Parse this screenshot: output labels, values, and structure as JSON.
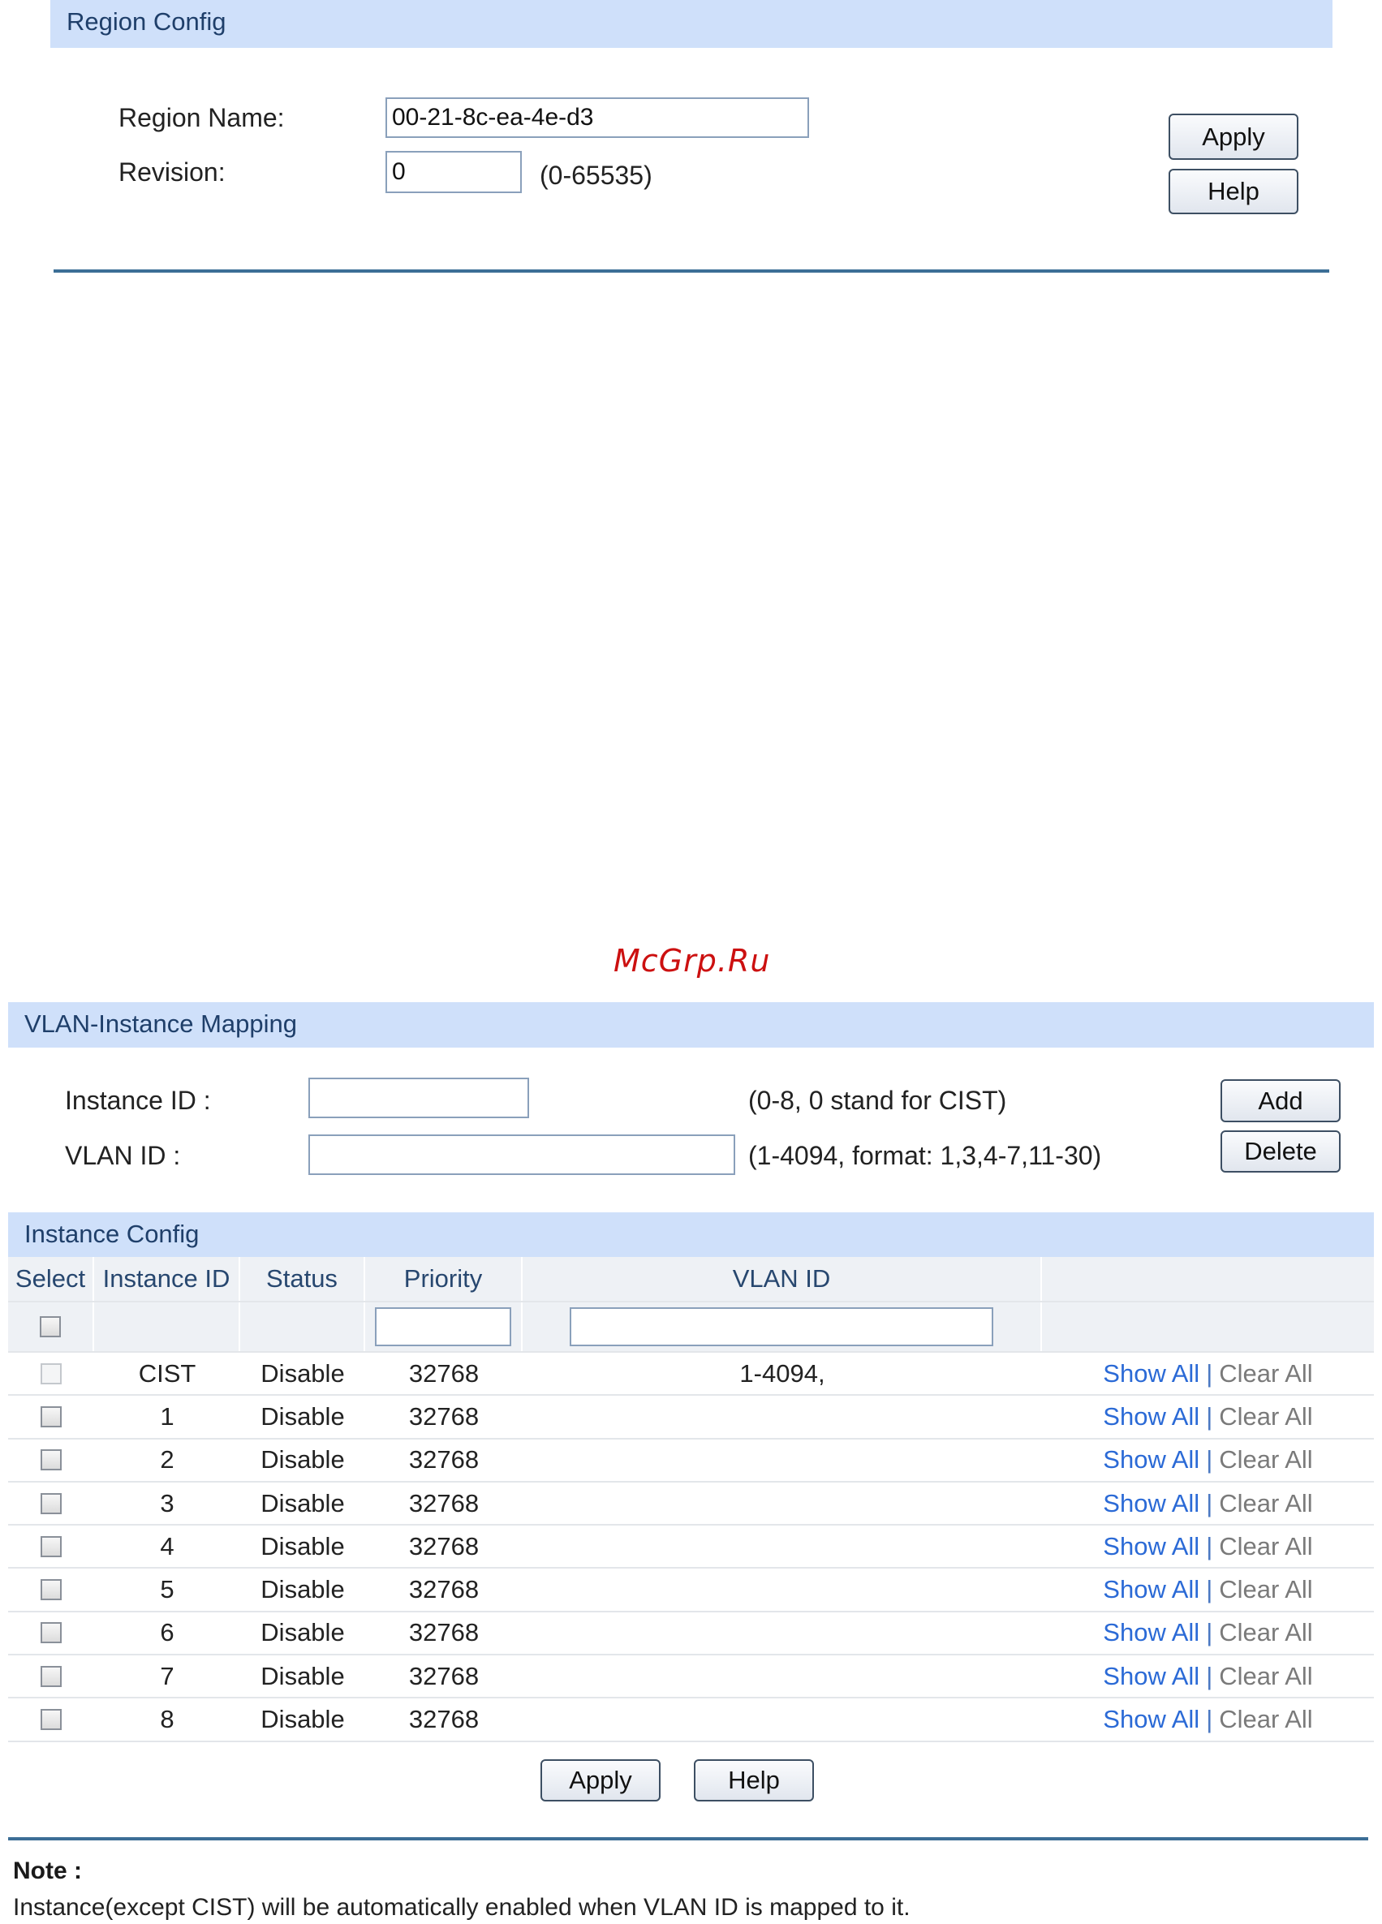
{
  "region": {
    "header": "Region Config",
    "name_label": "Region Name:",
    "name_value": "00-21-8c-ea-4e-d3",
    "revision_label": "Revision:",
    "revision_value": "0",
    "revision_hint": "(0-65535)",
    "apply_label": "Apply",
    "help_label": "Help"
  },
  "watermark": "McGrp.Ru",
  "mapping": {
    "header": "VLAN-Instance Mapping",
    "instance_label": "Instance ID :",
    "instance_value": "",
    "instance_hint": "(0-8, 0 stand for CIST)",
    "vlan_label": "VLAN ID :",
    "vlan_value": "",
    "vlan_hint": "(1-4094, format: 1,3,4-7,11-30)",
    "add_label": "Add",
    "delete_label": "Delete"
  },
  "instances": {
    "header": "Instance Config",
    "columns": [
      "Select",
      "Instance ID",
      "Status",
      "Priority",
      "VLAN ID",
      ""
    ],
    "filter": {
      "priority": "",
      "vlan": ""
    },
    "rows": [
      {
        "id": "CIST",
        "status": "Disable",
        "priority": "32768",
        "vlan": "1-4094,",
        "checked": false,
        "disabled": true
      },
      {
        "id": "1",
        "status": "Disable",
        "priority": "32768",
        "vlan": "",
        "checked": false,
        "disabled": false
      },
      {
        "id": "2",
        "status": "Disable",
        "priority": "32768",
        "vlan": "",
        "checked": false,
        "disabled": false
      },
      {
        "id": "3",
        "status": "Disable",
        "priority": "32768",
        "vlan": "",
        "checked": false,
        "disabled": false
      },
      {
        "id": "4",
        "status": "Disable",
        "priority": "32768",
        "vlan": "",
        "checked": false,
        "disabled": false
      },
      {
        "id": "5",
        "status": "Disable",
        "priority": "32768",
        "vlan": "",
        "checked": false,
        "disabled": false
      },
      {
        "id": "6",
        "status": "Disable",
        "priority": "32768",
        "vlan": "",
        "checked": false,
        "disabled": false
      },
      {
        "id": "7",
        "status": "Disable",
        "priority": "32768",
        "vlan": "",
        "checked": false,
        "disabled": false
      },
      {
        "id": "8",
        "status": "Disable",
        "priority": "32768",
        "vlan": "",
        "checked": false,
        "disabled": false
      }
    ],
    "show_all_label": "Show All",
    "separator": "|",
    "clear_all_label": "Clear All",
    "apply_label": "Apply",
    "help_label": "Help"
  },
  "note": {
    "title": "Note :",
    "text": "Instance(except CIST) will be automatically enabled when VLAN ID is mapped to it."
  },
  "colors": {
    "header_bg": "#cfe0fa",
    "rule": "#3c6e96",
    "link": "#2b6ad6",
    "watermark": "#cc1010"
  }
}
